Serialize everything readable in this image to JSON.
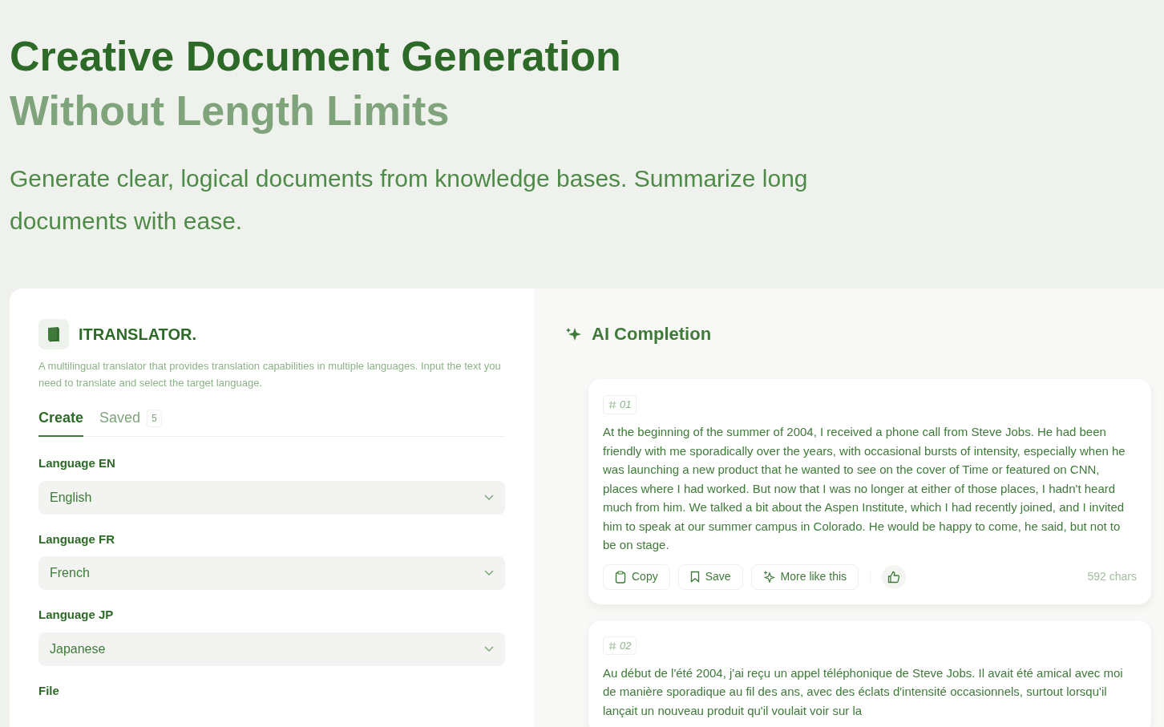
{
  "hero": {
    "title_line_1": "Creative Document Generation",
    "title_line_2": "Without Length Limits",
    "subtitle": "Generate clear, logical documents from knowledge bases. Summarize long documents with ease."
  },
  "app": {
    "name": "ITRANSLATOR.",
    "description": "A multilingual translator that provides translation capabilities in multiple languages. Input the text you need to translate and select the target language.",
    "tabs": [
      {
        "label": "Create",
        "selected": true
      },
      {
        "label": "Saved",
        "count": "5",
        "selected": false
      }
    ],
    "fields": [
      {
        "kind": "select",
        "label": "Language EN",
        "value": "English"
      },
      {
        "kind": "select",
        "label": "Language FR",
        "value": "French"
      },
      {
        "kind": "select",
        "label": "Language JP",
        "value": "Japanese"
      },
      {
        "kind": "file",
        "label": "File"
      }
    ]
  },
  "completion": {
    "title": "AI Completion",
    "results": [
      {
        "number": "01",
        "text": "At the beginning of the summer of 2004, I received a phone call from Steve Jobs. He had been friendly with me sporadically over the years, with occasional bursts of intensity, especially when he was launching a new product that he wanted to see on the cover of Time or featured on CNN, places where I had worked. But now that I was no longer at either of those places, I hadn't heard much from him. We talked a bit about the Aspen Institute, which I had recently joined, and I invited him to speak at our summer campus in Colorado. He would be happy to come, he said, but not to be on stage.",
        "actions": [
          "Copy",
          "Save",
          "More like this"
        ],
        "chars": "592 chars"
      },
      {
        "number": "02",
        "text": "Au début de l'été 2004, j'ai reçu un appel téléphonique de Steve Jobs. Il avait été amical avec moi de manière sporadique au fil des ans, avec des éclats d'intensité occasionnels, surtout lorsqu'il lançait un nouveau produit qu'il voulait voir sur la"
      }
    ]
  }
}
